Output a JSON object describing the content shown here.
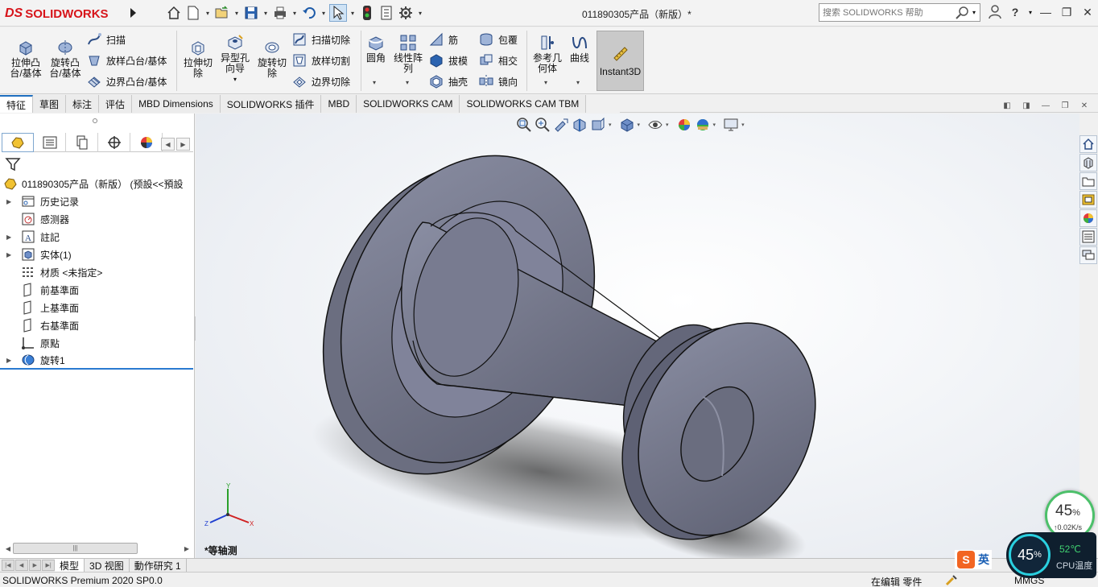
{
  "app": {
    "logo_prefix": "DS",
    "logo_text": "SOLIDWORKS",
    "document_title": "011890305产品（新版）*",
    "search_placeholder": "搜索 SOLIDWORKS 帮助"
  },
  "quick_access": [
    "home-icon",
    "new-document-icon",
    "open-icon",
    "save-icon",
    "print-icon",
    "undo-icon",
    "select-icon",
    "rebuild-icon",
    "file-properties-icon",
    "options-icon"
  ],
  "ribbon": {
    "extrude_boss": "拉伸凸\n台/基体",
    "revolve_boss": "旋转凸\n台/基体",
    "sweep": "扫描",
    "loft_boss": "放样凸台/基体",
    "boundary_boss": "边界凸台/基体",
    "extrude_cut": "拉伸切\n除",
    "hole_wizard": "异型孔\n向导",
    "revolve_cut": "旋转切\n除",
    "sweep_cut": "扫描切除",
    "loft_cut": "放样切割",
    "boundary_cut": "边界切除",
    "fillet": "圆角",
    "linear_pattern": "线性阵\n列",
    "rib": "筋",
    "draft": "拔模",
    "shell": "抽壳",
    "wrap": "包覆",
    "intersect": "相交",
    "mirror": "镜向",
    "ref_geometry": "参考几\n何体",
    "curves": "曲线",
    "instant3d": "Instant3D"
  },
  "tabs": [
    "特征",
    "草图",
    "标注",
    "评估",
    "MBD Dimensions",
    "SOLIDWORKS 插件",
    "MBD",
    "SOLIDWORKS CAM",
    "SOLIDWORKS CAM TBM"
  ],
  "active_tab": "特征",
  "tree": {
    "root": "011890305产品（新版） (预設<<預設",
    "items": [
      {
        "label": "历史记录",
        "expandable": true,
        "icon": "history-icon"
      },
      {
        "label": "感测器",
        "expandable": false,
        "icon": "sensor-icon"
      },
      {
        "label": "註記",
        "expandable": true,
        "icon": "annotation-icon"
      },
      {
        "label": "实体(1)",
        "expandable": true,
        "icon": "solid-body-icon"
      },
      {
        "label": "材质 <未指定>",
        "expandable": false,
        "icon": "material-icon"
      },
      {
        "label": "前基準面",
        "expandable": false,
        "icon": "plane-icon"
      },
      {
        "label": "上基準面",
        "expandable": false,
        "icon": "plane-icon"
      },
      {
        "label": "右基準面",
        "expandable": false,
        "icon": "plane-icon"
      },
      {
        "label": "原點",
        "expandable": false,
        "icon": "origin-icon"
      },
      {
        "label": "旋转1",
        "expandable": true,
        "icon": "revolve-feature-icon"
      }
    ]
  },
  "viewport": {
    "view_label": "*等轴测",
    "triad": {
      "x": "X",
      "y": "Y",
      "z": "Z"
    },
    "background_color": "#f2f4f8",
    "part_color": "#74778a"
  },
  "bottom_tabs": [
    "模型",
    "3D 视图",
    "動作研究 1"
  ],
  "active_bottom_tab": "模型",
  "status": {
    "product": "SOLIDWORKS Premium 2020 SP0.0",
    "editing": "在编辑 零件",
    "units": "MMGS"
  },
  "ime": {
    "lang": "英"
  },
  "system_monitor": {
    "cpu_percent": "45",
    "cpu_percent_unit": "%",
    "cpu_temp": "52℃",
    "cpu_temp_label": "CPU温度",
    "net_percent": "45",
    "net_percent_unit": "%",
    "net_rate": "↑0.02K/s"
  },
  "colors": {
    "accent": "#1f6fbf",
    "brand": "#d7141a",
    "ring": "#2ad0e0"
  }
}
